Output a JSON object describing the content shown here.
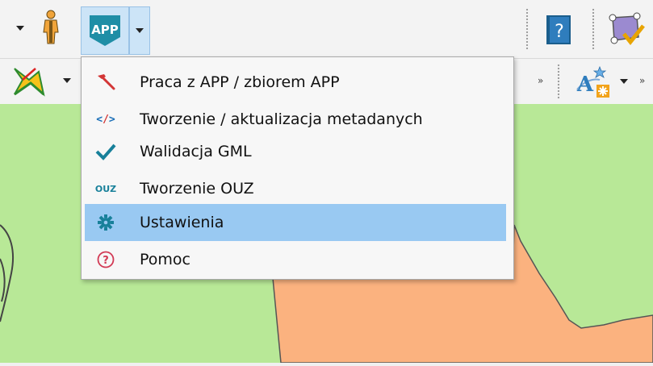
{
  "toolbar": {
    "app_badge": "APP",
    "help_glyph": "?",
    "overflow_chevron": "»"
  },
  "menu": {
    "items": [
      {
        "label": "Praca z APP / zbiorem APP",
        "icon": "hammer-icon"
      },
      {
        "label": "Tworzenie / aktualizacja metadanych",
        "icon": "code-tag-icon",
        "icon_text": "</>"
      },
      {
        "label": "Walidacja GML",
        "icon": "checkmark-icon"
      },
      {
        "label": "Tworzenie OUZ",
        "icon": "ouz-text-icon",
        "icon_text": "OUZ"
      },
      {
        "label": "Ustawienia",
        "icon": "gear-icon",
        "selected": true
      },
      {
        "label": "Pomoc",
        "icon": "help-circle-icon",
        "icon_text": "?"
      }
    ]
  },
  "colors": {
    "selection": "#99c9f2",
    "map_green": "#b8e897",
    "map_orange": "#fbb27f",
    "app_teal": "#1f8ea6",
    "check_teal": "#18809a",
    "help_red": "#d23a55"
  }
}
